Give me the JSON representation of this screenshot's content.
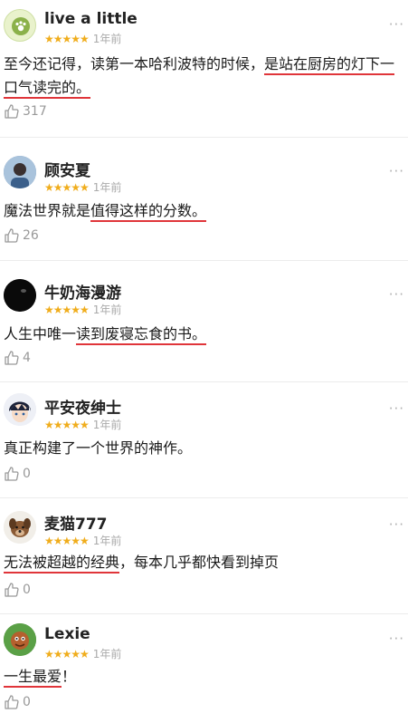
{
  "reviews": [
    {
      "user": "live a little",
      "stars": "★★★★★",
      "time": "1年前",
      "text_parts": [
        "至今还记得，读第一本哈利波特的时候，",
        "是站在厨房的灯下一口气读完的。"
      ],
      "likes": "317",
      "more": "···"
    },
    {
      "user": "顾安夏",
      "stars": "★★★★★",
      "time": "1年前",
      "text_parts": [
        "魔法世界就是",
        "值得这样的分数。"
      ],
      "likes": "26",
      "more": "···"
    },
    {
      "user": "牛奶海漫游",
      "stars": "★★★★★",
      "time": "1年前",
      "text_parts": [
        "人生中唯一",
        "读到废寝忘食的书。"
      ],
      "likes": "4",
      "more": "···"
    },
    {
      "user": "平安夜绅士",
      "stars": "★★★★★",
      "time": "1年前",
      "text_parts": [
        "真正构建了一个世界的神作。"
      ],
      "likes": "0",
      "more": "···"
    },
    {
      "user": "麦猫777",
      "stars": "★★★★★",
      "time": "1年前",
      "text_parts": [
        "无法被超越的经典",
        "，每本几乎都快看到掉页"
      ],
      "likes": "0",
      "more": "···"
    },
    {
      "user": "Lexie",
      "stars": "★★★★★",
      "time": "1年前",
      "text_parts": [
        "一生最爱",
        "！"
      ],
      "likes": "0",
      "more": "···"
    }
  ],
  "colors": {
    "star": "#f0ad1c",
    "underline": "#e0353a",
    "meta": "#aaaaaa"
  }
}
